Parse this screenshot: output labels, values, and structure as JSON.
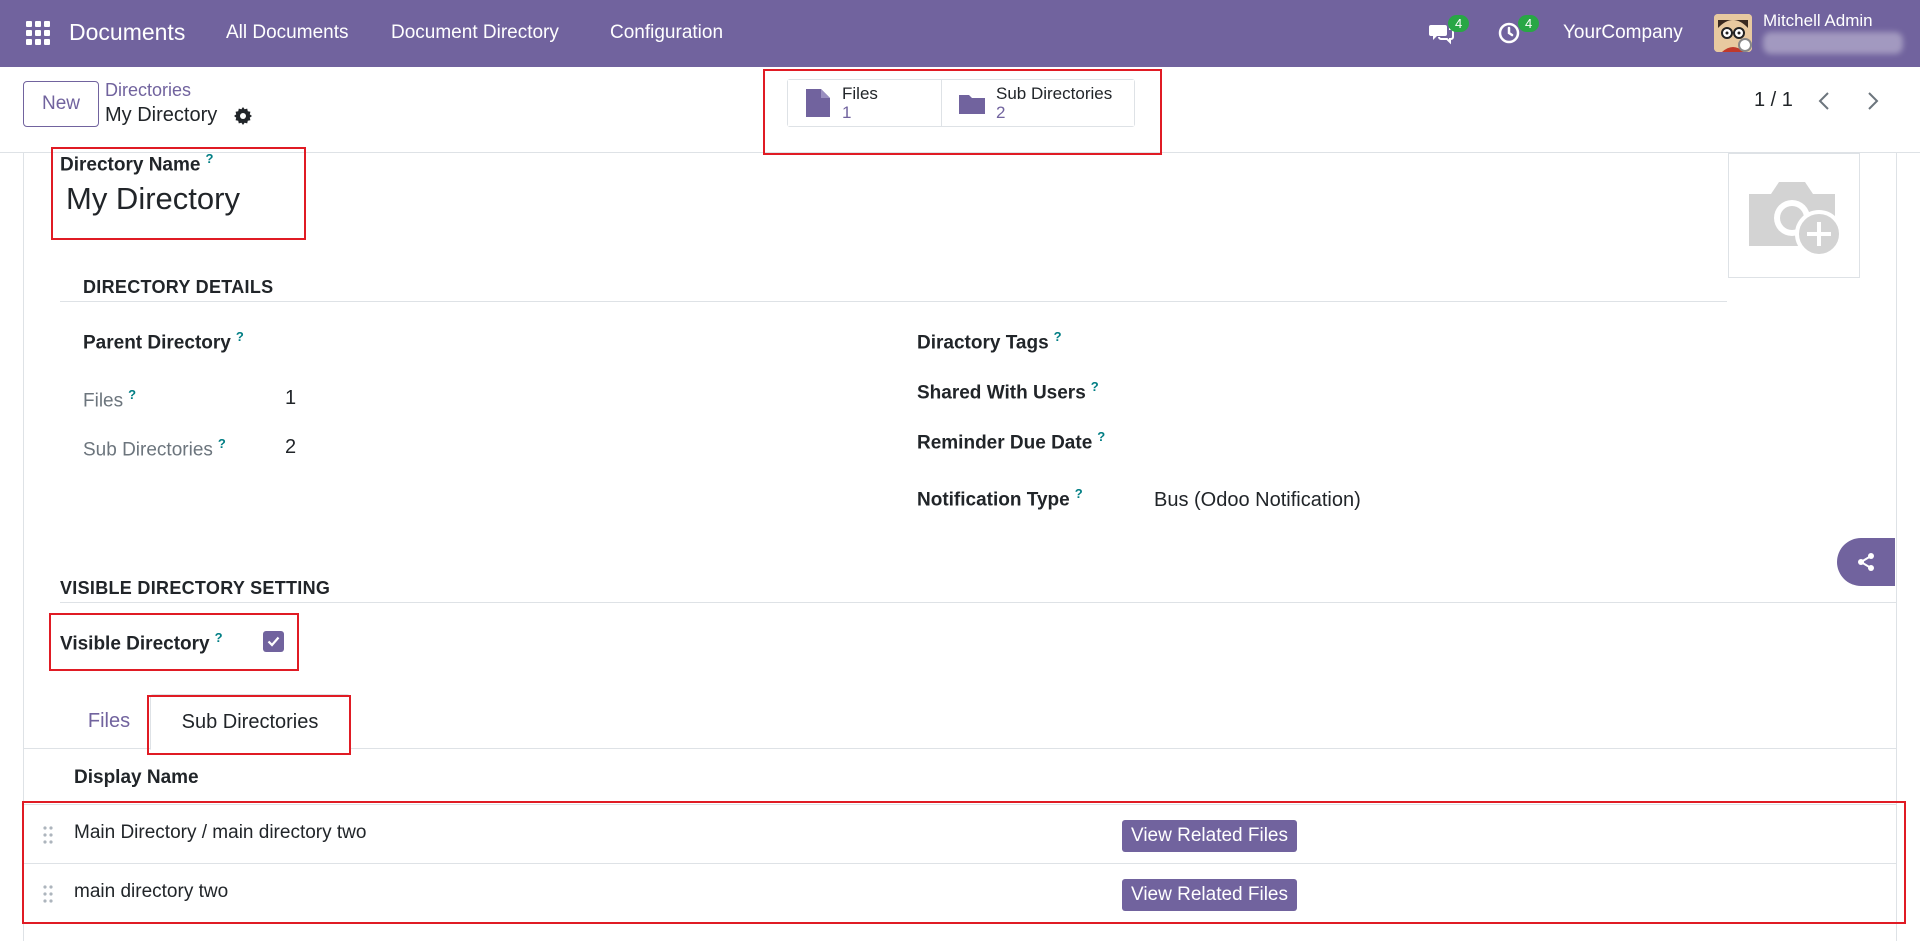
{
  "navbar": {
    "brand": "Documents",
    "menu": [
      "All Documents",
      "Document Directory",
      "Configuration"
    ],
    "chat_count": "4",
    "activity_count": "4",
    "company": "YourCompany",
    "user_name": "Mitchell Admin"
  },
  "control_panel": {
    "new_label": "New",
    "breadcrumb_parent": "Directories",
    "breadcrumb_current": "My Directory",
    "smart_buttons": [
      {
        "label": "Files",
        "value": "1",
        "icon": "file-icon"
      },
      {
        "label": "Sub Directories",
        "value": "2",
        "icon": "folder-icon"
      }
    ],
    "pager": "1 / 1"
  },
  "form": {
    "name_label": "Directory Name",
    "name_help": "?",
    "name_value": "My Directory",
    "details_title": "DIRECTORY DETAILS",
    "parent_label": "Parent Directory",
    "files_label": "Files",
    "files_value": "1",
    "subdirs_label": "Sub Directories",
    "subdirs_value": "2",
    "tags_label": "Diractory Tags",
    "shared_label": "Shared With Users",
    "reminder_label": "Reminder Due Date",
    "notif_label": "Notification Type",
    "notif_value": "Bus (Odoo Notification)",
    "visible_title": "VISIBLE DIRECTORY SETTING",
    "visible_label": "Visible Directory",
    "visible_checked": true,
    "help_mark": "?"
  },
  "tabs": {
    "files": "Files",
    "sub_directories": "Sub Directories",
    "active": "sub_directories"
  },
  "list": {
    "column": "Display Name",
    "rows": [
      {
        "name": "Main Directory / main directory two",
        "button": "View Related Files"
      },
      {
        "name": "main directory two",
        "button": "View Related Files"
      }
    ]
  },
  "colors": {
    "primary": "#71639e",
    "badge": "#28a745",
    "highlight": "#e01b24",
    "help": "#017e84"
  }
}
